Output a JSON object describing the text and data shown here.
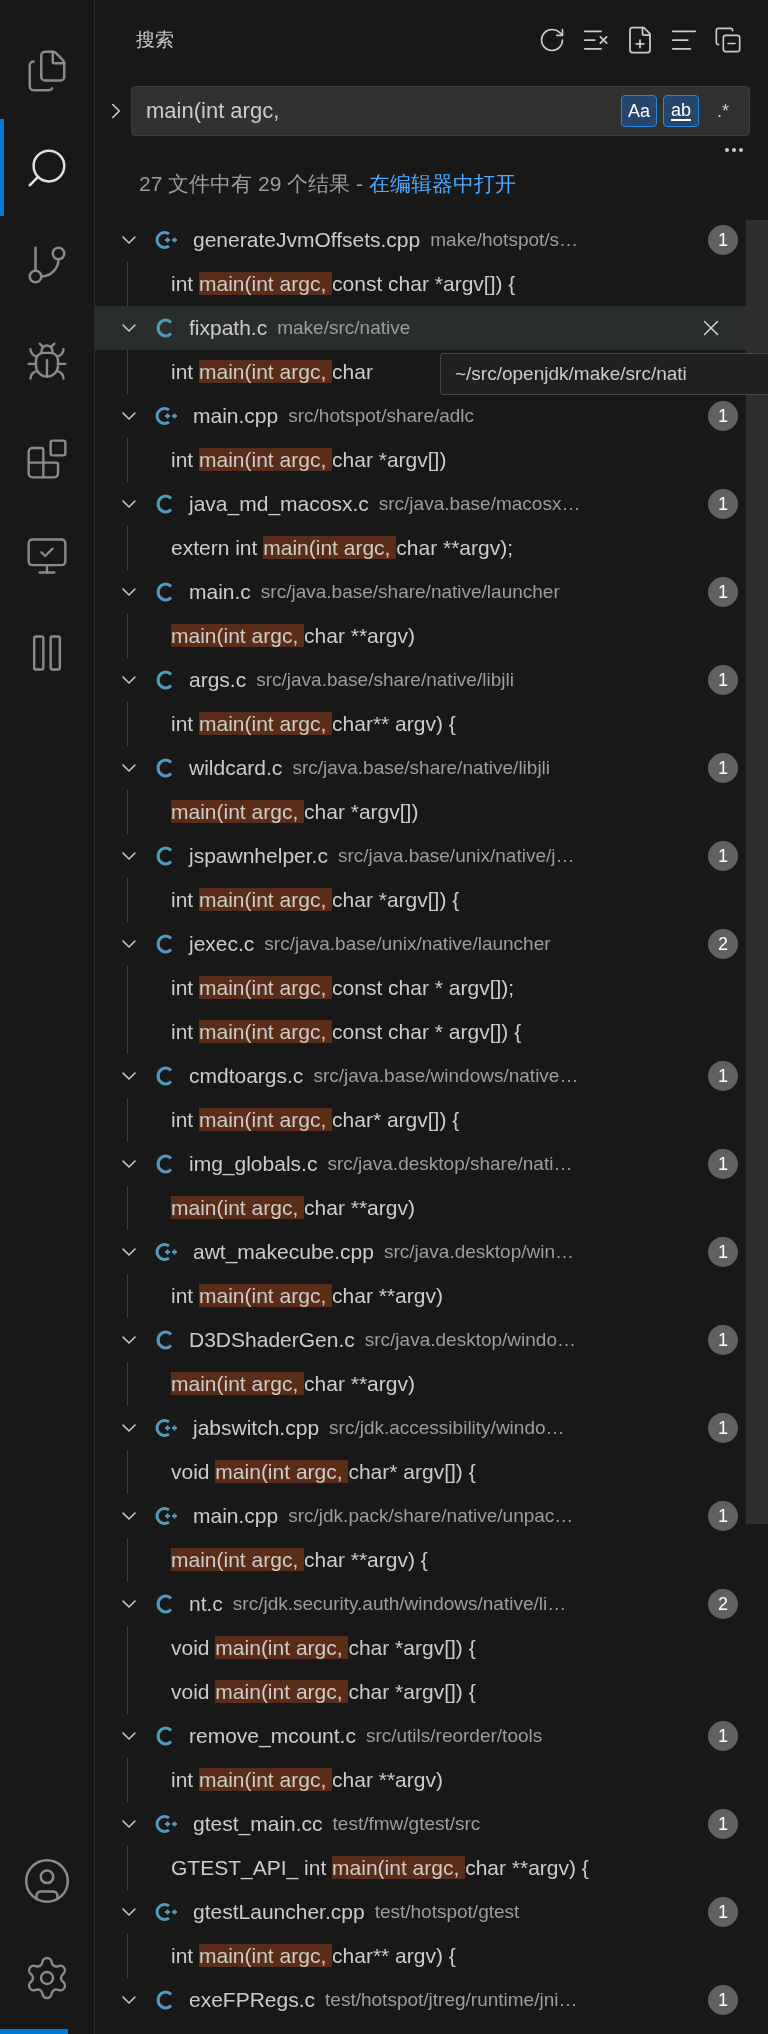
{
  "activity_bar": {
    "items": [
      {
        "kind": "files",
        "selected": false
      },
      {
        "kind": "search",
        "selected": true
      },
      {
        "kind": "source-control",
        "selected": false
      },
      {
        "kind": "run-debug",
        "selected": false
      },
      {
        "kind": "extensions",
        "selected": false
      },
      {
        "kind": "remote",
        "selected": false
      },
      {
        "kind": "pause",
        "selected": false
      }
    ],
    "bottom_items": [
      {
        "kind": "account"
      },
      {
        "kind": "settings"
      }
    ]
  },
  "panel": {
    "title": "搜索",
    "actions": [
      {
        "kind": "refresh"
      },
      {
        "kind": "clear"
      },
      {
        "kind": "new-editor"
      },
      {
        "kind": "tree"
      },
      {
        "kind": "collapse"
      }
    ]
  },
  "search": {
    "value": "main(int argc,",
    "toggles": [
      {
        "kind": "case",
        "label": "Aa",
        "on": true
      },
      {
        "kind": "word",
        "label": "ab",
        "on": true
      },
      {
        "kind": "regex",
        "label": ".*",
        "on": false
      }
    ]
  },
  "summary": {
    "text": "27 文件中有 29 个结果 - ",
    "link": "在编辑器中打开"
  },
  "results": [
    {
      "kind": "cpp",
      "name": "generateJvmOffsets.cpp",
      "path": "make/hotspot/s…",
      "count": "1",
      "hovered": false,
      "lines": [
        {
          "before": "int ",
          "match": "main(int argc,",
          "after": " const char *argv[]) {"
        }
      ]
    },
    {
      "kind": "c",
      "name": "fixpath.c",
      "path": "make/src/native",
      "hovered": true,
      "lines": [
        {
          "before": "int ",
          "match": "main(int argc,",
          "after": " char"
        }
      ]
    },
    {
      "kind": "cpp",
      "name": "main.cpp",
      "path": "src/hotspot/share/adlc",
      "count": "1",
      "hovered": false,
      "lines": [
        {
          "before": "int ",
          "match": "main(int argc,",
          "after": " char *argv[])"
        }
      ]
    },
    {
      "kind": "c",
      "name": "java_md_macosx.c",
      "path": "src/java.base/macosx…",
      "count": "1",
      "hovered": false,
      "lines": [
        {
          "before": "extern int ",
          "match": "main(int argc,",
          "after": " char **argv);"
        }
      ]
    },
    {
      "kind": "c",
      "name": "main.c",
      "path": "src/java.base/share/native/launcher",
      "count": "1",
      "hovered": false,
      "lines": [
        {
          "match": "main(int argc,",
          "after": " char **argv)"
        }
      ]
    },
    {
      "kind": "c",
      "name": "args.c",
      "path": "src/java.base/share/native/libjli",
      "count": "1",
      "hovered": false,
      "lines": [
        {
          "before": "int ",
          "match": "main(int argc,",
          "after": " char** argv) {"
        }
      ]
    },
    {
      "kind": "c",
      "name": "wildcard.c",
      "path": "src/java.base/share/native/libjli",
      "count": "1",
      "hovered": false,
      "lines": [
        {
          "match": "main(int argc,",
          "after": " char *argv[])"
        }
      ]
    },
    {
      "kind": "c",
      "name": "jspawnhelper.c",
      "path": "src/java.base/unix/native/j…",
      "count": "1",
      "hovered": false,
      "lines": [
        {
          "before": "int ",
          "match": "main(int argc,",
          "after": " char *argv[]) {"
        }
      ]
    },
    {
      "kind": "c",
      "name": "jexec.c",
      "path": "src/java.base/unix/native/launcher",
      "count": "2",
      "hovered": false,
      "lines": [
        {
          "before": "int ",
          "match": "main(int argc,",
          "after": " const char * argv[]);"
        },
        {
          "before": "int ",
          "match": "main(int argc,",
          "after": " const char * argv[]) {"
        }
      ]
    },
    {
      "kind": "c",
      "name": "cmdtoargs.c",
      "path": "src/java.base/windows/native…",
      "count": "1",
      "hovered": false,
      "lines": [
        {
          "before": "int ",
          "match": "main(int argc,",
          "after": " char* argv[]) {"
        }
      ]
    },
    {
      "kind": "c",
      "name": "img_globals.c",
      "path": "src/java.desktop/share/nati…",
      "count": "1",
      "hovered": false,
      "lines": [
        {
          "match": "main(int argc,",
          "after": " char **argv)"
        }
      ]
    },
    {
      "kind": "cpp",
      "name": "awt_makecube.cpp",
      "path": "src/java.desktop/win…",
      "count": "1",
      "hovered": false,
      "lines": [
        {
          "before": "int ",
          "match": "main(int argc,",
          "after": " char **argv)"
        }
      ]
    },
    {
      "kind": "c",
      "name": "D3DShaderGen.c",
      "path": "src/java.desktop/windo…",
      "count": "1",
      "hovered": false,
      "lines": [
        {
          "match": "main(int argc,",
          "after": " char **argv)"
        }
      ]
    },
    {
      "kind": "cpp",
      "name": "jabswitch.cpp",
      "path": "src/jdk.accessibility/windo…",
      "count": "1",
      "hovered": false,
      "lines": [
        {
          "before": "void ",
          "match": "main(int argc,",
          "after": " char* argv[]) {"
        }
      ]
    },
    {
      "kind": "cpp",
      "name": "main.cpp",
      "path": "src/jdk.pack/share/native/unpac…",
      "count": "1",
      "hovered": false,
      "lines": [
        {
          "match": "main(int argc,",
          "after": " char **argv) {"
        }
      ]
    },
    {
      "kind": "c",
      "name": "nt.c",
      "path": "src/jdk.security.auth/windows/native/li…",
      "count": "2",
      "hovered": false,
      "lines": [
        {
          "before": "void ",
          "match": "main(int argc,",
          "after": " char *argv[]) {"
        },
        {
          "before": "void ",
          "match": "main(int argc,",
          "after": " char *argv[]) {"
        }
      ]
    },
    {
      "kind": "c",
      "name": "remove_mcount.c",
      "path": "src/utils/reorder/tools",
      "count": "1",
      "hovered": false,
      "lines": [
        {
          "before": "int ",
          "match": "main(int argc,",
          "after": " char **argv)"
        }
      ]
    },
    {
      "kind": "cpp",
      "name": "gtest_main.cc",
      "path": "test/fmw/gtest/src",
      "count": "1",
      "hovered": false,
      "lines": [
        {
          "before": "GTEST_API_ int ",
          "match": "main(int argc,",
          "after": " char **argv) {"
        }
      ]
    },
    {
      "kind": "cpp",
      "name": "gtestLauncher.cpp",
      "path": "test/hotspot/gtest",
      "count": "1",
      "hovered": false,
      "lines": [
        {
          "before": "int ",
          "match": "main(int argc,",
          "after": " char** argv) {"
        }
      ]
    },
    {
      "kind": "c",
      "name": "exeFPRegs.c",
      "path": "test/hotspot/jtreg/runtime/jni…",
      "count": "1",
      "hovered": false
    }
  ],
  "tooltip": {
    "text": "~/src/openjdk/make/src/nati"
  }
}
